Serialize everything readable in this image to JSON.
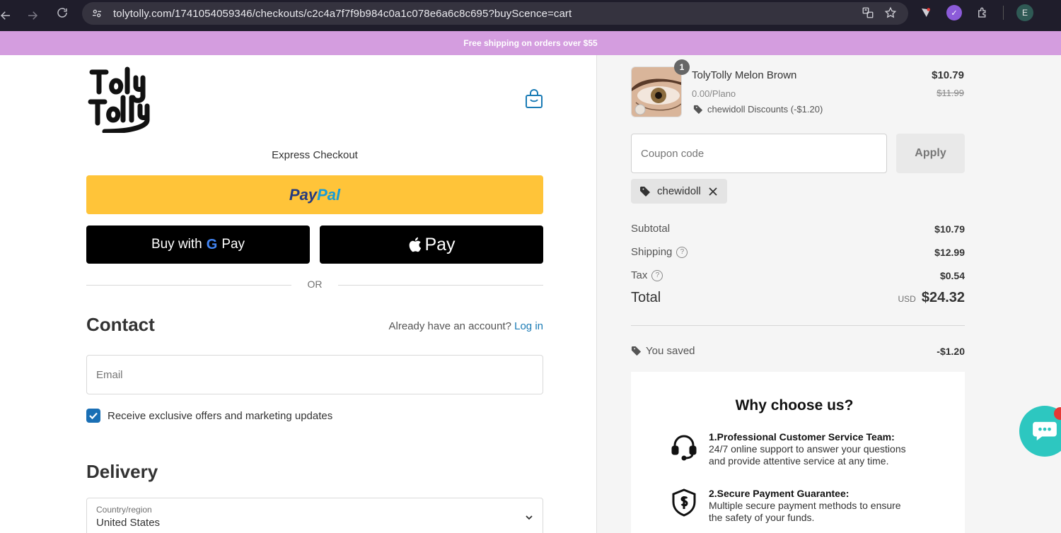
{
  "browser": {
    "url": "tolytolly.com/1741054059346/checkouts/c2c4a7f7f9b984c0a1c078e6a6c8c695?buyScence=cart",
    "profile_initial": "E"
  },
  "announcement": "Free shipping on orders over $55",
  "checkout": {
    "express_title": "Express Checkout",
    "paypal_part1": "Pay",
    "paypal_part2": "Pal",
    "gpay_prefix": "Buy with",
    "gpay_g": "G",
    "gpay_label": "Pay",
    "applepay_label": "Pay",
    "or_text": "OR",
    "contact_heading": "Contact",
    "account_prompt": "Already have an account?",
    "login_link": "Log in",
    "email_placeholder": "Email",
    "marketing_label": "Receive exclusive offers and marketing updates",
    "marketing_checked": true,
    "delivery_heading": "Delivery",
    "country_label": "Country/region",
    "country_value": "United States"
  },
  "order": {
    "quantity": "1",
    "product_name": "TolyTolly Melon Brown",
    "variant": "0.00/Plano",
    "discount_line": "chewidoll Discounts (-$1.20)",
    "price": "$10.79",
    "compare_price": "$11.99",
    "coupon_placeholder": "Coupon code",
    "apply_label": "Apply",
    "applied_code": "chewidoll",
    "subtotal_label": "Subtotal",
    "subtotal_value": "$10.79",
    "shipping_label": "Shipping",
    "shipping_value": "$12.99",
    "tax_label": "Tax",
    "tax_value": "$0.54",
    "total_label": "Total",
    "currency": "USD",
    "total_value": "$24.32",
    "saved_label": "You saved",
    "saved_value": "-$1.20"
  },
  "why": {
    "title": "Why choose us?",
    "features": [
      {
        "title": "1.Professional Customer Service Team:",
        "line1": "24/7 online support to answer your questions",
        "line2": "and provide attentive service at any time."
      },
      {
        "title": "2.Secure Payment Guarantee:",
        "line1": "Multiple secure payment methods to ensure",
        "line2": "the safety of your funds."
      }
    ]
  },
  "colors": {
    "announcement_bg": "#d49ddf",
    "paypal_yellow": "#ffc439",
    "link_blue": "#1a7bb5",
    "chat_teal": "#2dc7c0"
  }
}
